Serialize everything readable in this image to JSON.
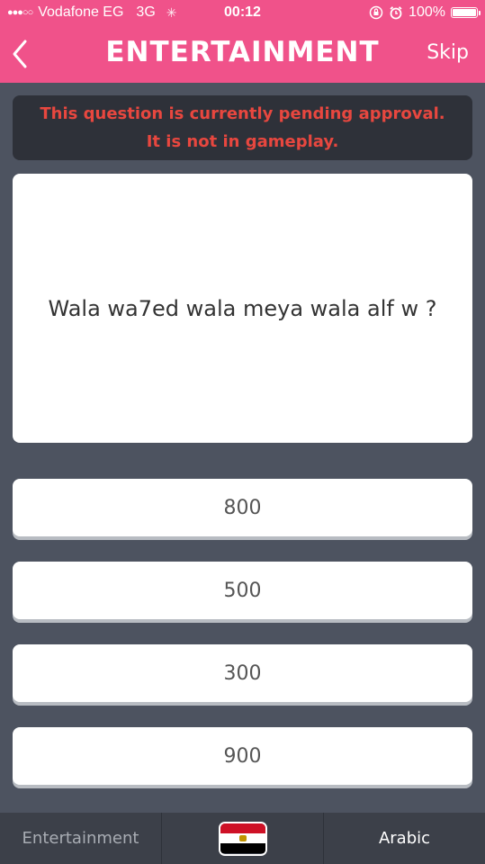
{
  "status_bar": {
    "carrier": "Vodafone EG",
    "network": "3G",
    "time": "00:12",
    "battery": "100%"
  },
  "header": {
    "title": "ENTERTAINMENT",
    "skip_label": "Skip"
  },
  "notice": {
    "line1": "This question is currently pending approval.",
    "line2": "It is not in gameplay."
  },
  "question": {
    "text": "Wala wa7ed wala meya wala alf w ?"
  },
  "answers": [
    {
      "label": "800"
    },
    {
      "label": "500"
    },
    {
      "label": "300"
    },
    {
      "label": "900"
    }
  ],
  "tab_bar": {
    "category": "Entertainment",
    "flag_icon": "egypt-flag-icon",
    "language": "Arabic"
  },
  "colors": {
    "header": "#f0528a",
    "background": "#4d5360",
    "notice_text": "#e8473f",
    "tab_bar": "#3c4049"
  }
}
